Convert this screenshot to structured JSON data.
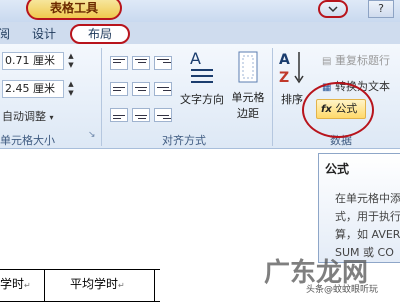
{
  "title_bar": {
    "tools_tab": "表格工具",
    "help": "?"
  },
  "tabs": {
    "view_partial": "阅",
    "design": "设计",
    "layout": "布局"
  },
  "cell_size": {
    "height_value": "0.71 厘米",
    "width_value": "2.45 厘米",
    "autofit": "自动调整",
    "group_label": "单元格大小"
  },
  "alignment": {
    "text_direction": "文字方向",
    "cell_margins_line1": "单元格",
    "cell_margins_line2": "边距",
    "group_label": "对齐方式"
  },
  "data": {
    "sort": "排序",
    "repeat_header": "重复标题行",
    "convert_to_text": "转换为文本",
    "formula": "公式",
    "group_label": "数据"
  },
  "tooltip": {
    "title": "公式",
    "lines": [
      "在单元格中添",
      "式，用于执行",
      "算，如 AVER",
      "SUM 或 CO"
    ]
  },
  "table": {
    "cell1": "学时",
    "cell2": "平均学时"
  },
  "watermark": "广东龙网",
  "credit": "头条@蚊蚊眼听玩"
}
